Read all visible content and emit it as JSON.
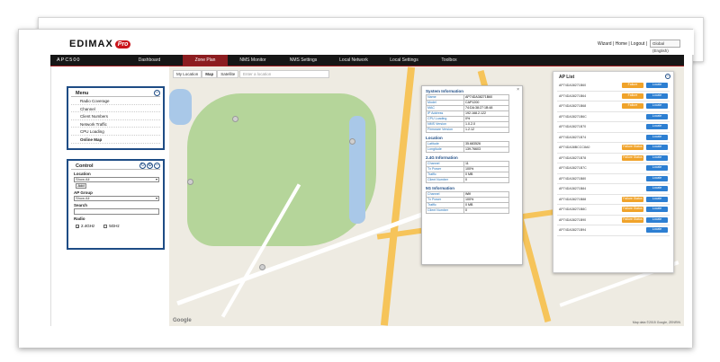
{
  "header": {
    "logo_text": "EDIMAX",
    "logo_badge": "Pro",
    "top_links": "Wizard | Home | Logout |",
    "language": "Global (English)"
  },
  "nav": {
    "brand": "APC500",
    "items": [
      "Dashboard",
      "Zone Plan",
      "NMS Monitor",
      "NMS Settings",
      "Local Network",
      "Local Settings",
      "Toolbox"
    ],
    "active": "Zone Plan"
  },
  "menu": {
    "title": "Menu",
    "items": [
      "Radio Coverage",
      "Channel",
      "Client Numbers",
      "Network Traffic",
      "CPU Loading",
      "Online Map"
    ]
  },
  "control": {
    "title": "Control",
    "location_label": "Location",
    "location_value": "Show All",
    "add_button": "Add",
    "apgroup_label": "AP Group",
    "apgroup_value": "Show All",
    "search_label": "Search",
    "radio_label": "Radio",
    "radio_24": "2.4GHz",
    "radio_5": "5GHz"
  },
  "map": {
    "tab_location": "My Location",
    "tab_map": "Map",
    "tab_satellite": "Satellite",
    "search_placeholder": "Enter a location",
    "google": "Google",
    "attribution": "Map data ©2015 Google, ZENRIN"
  },
  "info": {
    "system_title": "System Information",
    "system_rows": [
      [
        "Name",
        "AP74DA38271B60"
      ],
      [
        "Model",
        "CAP1200"
      ],
      [
        "MAC",
        "74:DA:38:27:1B:48"
      ],
      [
        "IP Address",
        "192.168.2.122"
      ],
      [
        "CPU Loading",
        "0%"
      ],
      [
        "NMS Version",
        "1.0.2.0"
      ],
      [
        "Firmware Version",
        "1.2.12"
      ]
    ],
    "location_title": "Location",
    "location_rows": [
      [
        "Latitude",
        "35.683526"
      ],
      [
        "Longitude",
        "139.76603"
      ]
    ],
    "g24_title": "2.4G Information",
    "g24_rows": [
      [
        "Channel",
        "11"
      ],
      [
        "Tx Power",
        "100%"
      ],
      [
        "Traffic",
        "0 MB"
      ],
      [
        "Client Number",
        "0"
      ]
    ],
    "g5_title": "5G Information",
    "g5_rows": [
      [
        "Channel",
        "Wifi"
      ],
      [
        "Tx Power",
        "100%"
      ],
      [
        "Traffic",
        "0 MB"
      ],
      [
        "Client Number",
        "0"
      ]
    ]
  },
  "aplist": {
    "title": "AP List",
    "rows": [
      {
        "name": "AP74DA38271B60",
        "status": "Failure",
        "action": "Locate"
      },
      {
        "name": "AP74DA38271B64",
        "status": "Failure",
        "action": "Locate"
      },
      {
        "name": "AP74DA38271B68",
        "status": "Failure",
        "action": "Locate"
      },
      {
        "name": "AP74DA38271B6C",
        "status": "",
        "action": "Locate"
      },
      {
        "name": "AP74DA38271B70",
        "status": "",
        "action": "Locate"
      },
      {
        "name": "AP74DA38271B74",
        "status": "",
        "action": "Locate"
      },
      {
        "name": "AP74DA38BCCC8A0",
        "status": "Failure Status",
        "action": "Locate"
      },
      {
        "name": "AP74DA38271B78",
        "status": "Failure Status",
        "action": "Locate"
      },
      {
        "name": "AP74DA38271B7C",
        "status": "",
        "action": "Locate"
      },
      {
        "name": "AP74DA38271B80",
        "status": "",
        "action": "Locate"
      },
      {
        "name": "AP74DA38271B84",
        "status": "",
        "action": "Locate"
      },
      {
        "name": "AP74DA38271B88",
        "status": "Failure Status",
        "action": "Locate"
      },
      {
        "name": "AP74DA38271B8C",
        "status": "Failure Status",
        "action": "Locate"
      },
      {
        "name": "AP74DA38271B90",
        "status": "Failure Status",
        "action": "Locate"
      },
      {
        "name": "AP74DA38271B94",
        "status": "",
        "action": "Locate"
      },
      {
        "name": "AP74DA38271B98",
        "status": "",
        "action": "Locate"
      }
    ]
  },
  "colors": {
    "nav_bg": "#161616",
    "active_tab": "#8c1d20",
    "box_border": "#1e4c85",
    "status_orange": "#f0a32a",
    "locate_blue": "#2d7fd2"
  }
}
